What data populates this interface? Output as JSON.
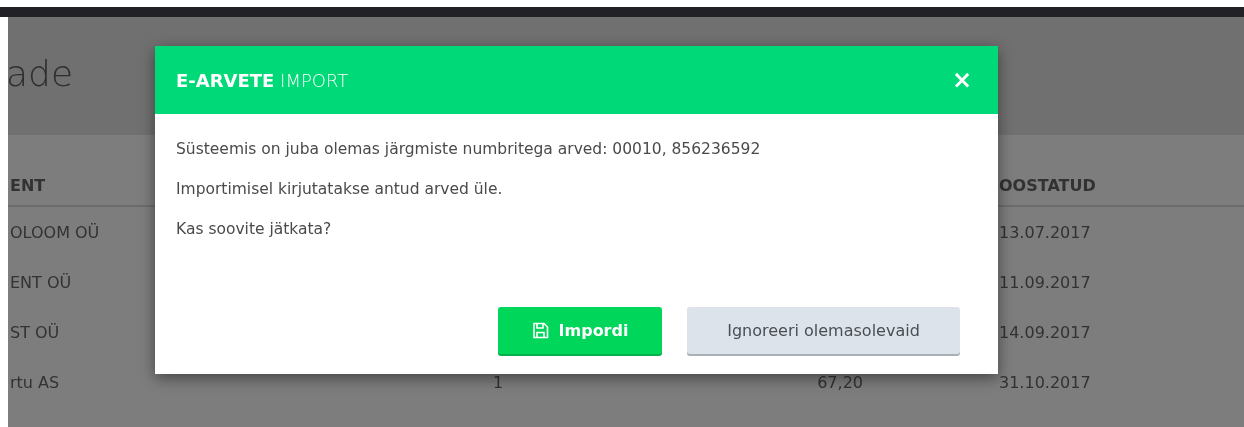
{
  "page": {
    "title": "ade"
  },
  "table": {
    "columns": [
      {
        "label": "ENT"
      },
      {
        "label": "OOSTATUD"
      }
    ],
    "rows": [
      {
        "client": "OLOOM OÜ",
        "date": "13.07.2017"
      },
      {
        "client": "ENT OÜ",
        "date": "11.09.2017"
      },
      {
        "client": "ST OÜ",
        "date": "14.09.2017"
      },
      {
        "client": "rtu AS",
        "quantity": "1",
        "sum": "67,20",
        "date": "31.10.2017"
      }
    ]
  },
  "dialog": {
    "title": "**E-ARVETE** IMPORT",
    "close": "×",
    "paragraphs": [
      "Süsteemis on juba olemas järgmiste numbritega arved: 00010, 856236592",
      "Importimisel kirjutatakse antud arved üle.",
      "Kas soovite jätkata?"
    ],
    "buttons": [
      {
        "label": "Impordi",
        "kind": "primary"
      },
      {
        "label": "Ignoreeri olemasolevaid",
        "kind": "secondary"
      }
    ]
  }
}
